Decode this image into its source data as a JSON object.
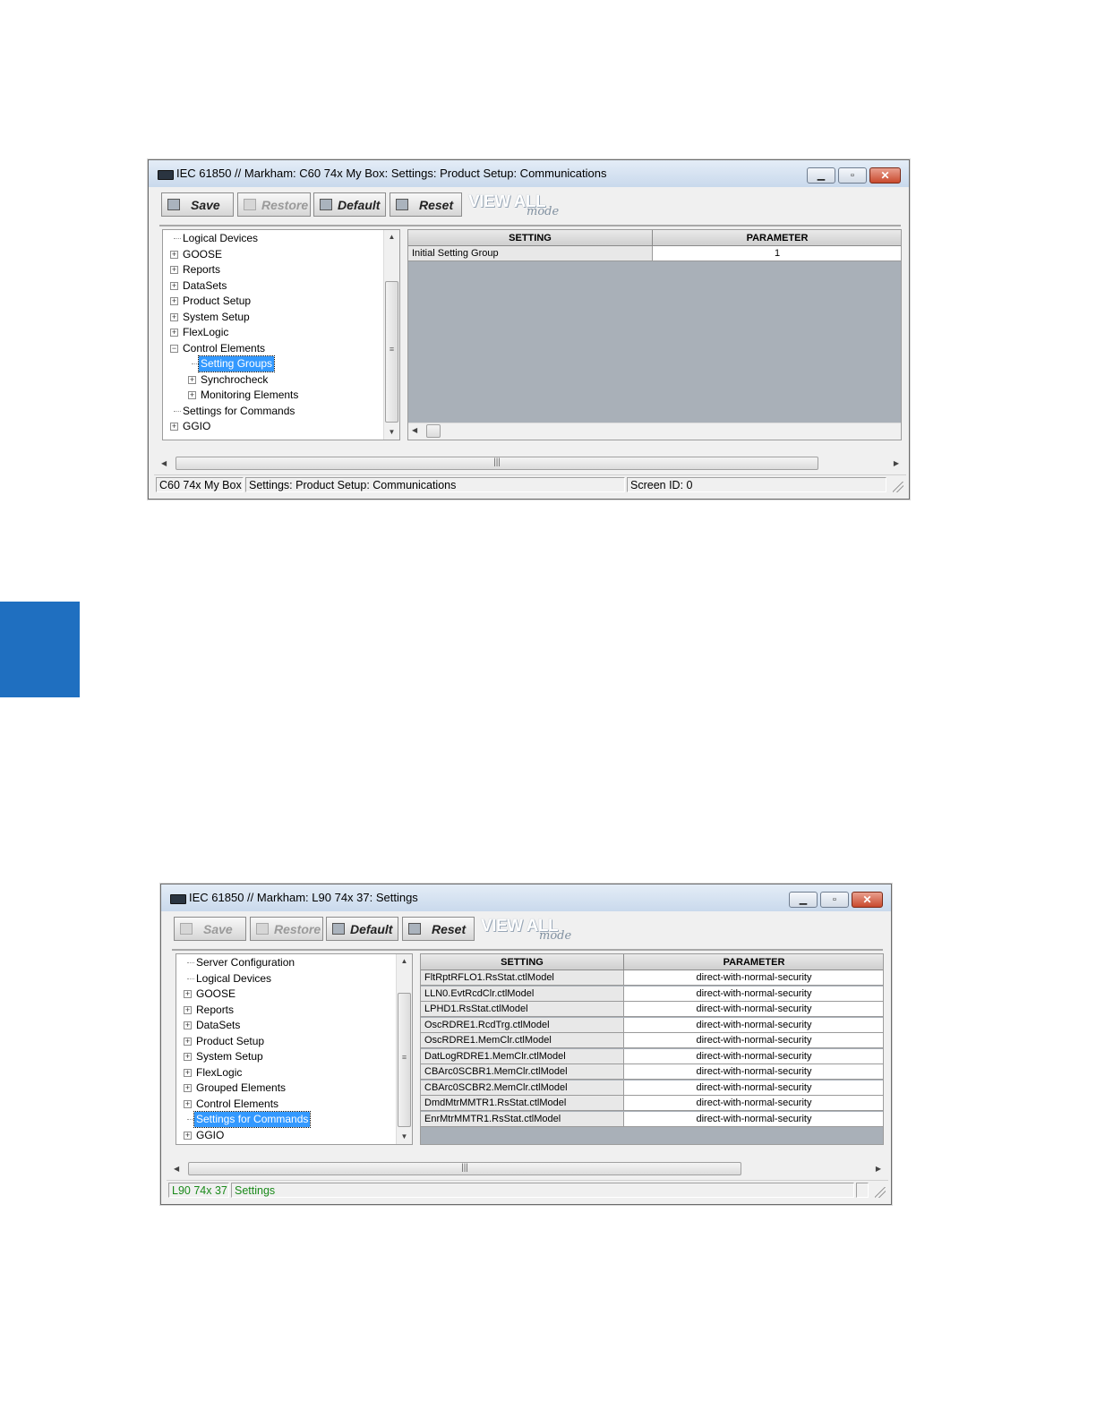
{
  "window1": {
    "title": "IEC 61850 // Markham: C60 74x My Box: Settings: Product Setup: Communications",
    "toolbar": {
      "save": "Save",
      "restore": "Restore",
      "default": "Default",
      "reset": "Reset",
      "view_all": "VIEW ALL",
      "mode": "mode"
    },
    "tree": [
      "Logical Devices",
      "GOOSE",
      "Reports",
      "DataSets",
      "Product Setup",
      "System Setup",
      "FlexLogic",
      "Control Elements",
      "Setting Groups",
      "Synchrocheck",
      "Monitoring Elements",
      "Settings for Commands",
      "GGIO"
    ],
    "selected": "Setting Groups",
    "grid": {
      "headers": {
        "setting": "SETTING",
        "parameter": "PARAMETER"
      },
      "rows": [
        {
          "setting": "Initial Setting Group",
          "parameter": "1"
        }
      ]
    },
    "status": {
      "device": "C60 74x My Box",
      "path": "Settings: Product Setup: Communications",
      "screen": "Screen ID: 0"
    }
  },
  "window2": {
    "title": "IEC 61850 // Markham: L90 74x 37: Settings",
    "toolbar": {
      "save": "Save",
      "restore": "Restore",
      "default": "Default",
      "reset": "Reset",
      "view_all": "VIEW ALL",
      "mode": "mode"
    },
    "tree": [
      "Server Configuration",
      "Logical Devices",
      "GOOSE",
      "Reports",
      "DataSets",
      "Product Setup",
      "System Setup",
      "FlexLogic",
      "Grouped Elements",
      "Control Elements",
      "Settings for Commands",
      "GGIO"
    ],
    "selected": "Settings for Commands",
    "grid": {
      "headers": {
        "setting": "SETTING",
        "parameter": "PARAMETER"
      },
      "rows": [
        {
          "setting": "FltRptRFLO1.RsStat.ctlModel",
          "parameter": "direct-with-normal-security"
        },
        {
          "setting": "LLN0.EvtRcdClr.ctlModel",
          "parameter": "direct-with-normal-security"
        },
        {
          "setting": "LPHD1.RsStat.ctlModel",
          "parameter": "direct-with-normal-security"
        },
        {
          "setting": "OscRDRE1.RcdTrg.ctlModel",
          "parameter": "direct-with-normal-security"
        },
        {
          "setting": "OscRDRE1.MemClr.ctlModel",
          "parameter": "direct-with-normal-security"
        },
        {
          "setting": "DatLogRDRE1.MemClr.ctlModel",
          "parameter": "direct-with-normal-security"
        },
        {
          "setting": "CBArc0SCBR1.MemClr.ctlModel",
          "parameter": "direct-with-normal-security"
        },
        {
          "setting": "CBArc0SCBR2.MemClr.ctlModel",
          "parameter": "direct-with-normal-security"
        },
        {
          "setting": "DmdMtrMMTR1.RsStat.ctlModel",
          "parameter": "direct-with-normal-security"
        },
        {
          "setting": "EnrMtrMMTR1.RsStat.ctlModel",
          "parameter": "direct-with-normal-security"
        }
      ]
    },
    "status": {
      "device": "L90 74x 37",
      "path": "Settings"
    }
  },
  "colors": {
    "side_tab": "#1f6fc0",
    "selection": "#3399ff",
    "grid_bg": "#a9b0b8",
    "status_green": "#1a8a1a"
  }
}
